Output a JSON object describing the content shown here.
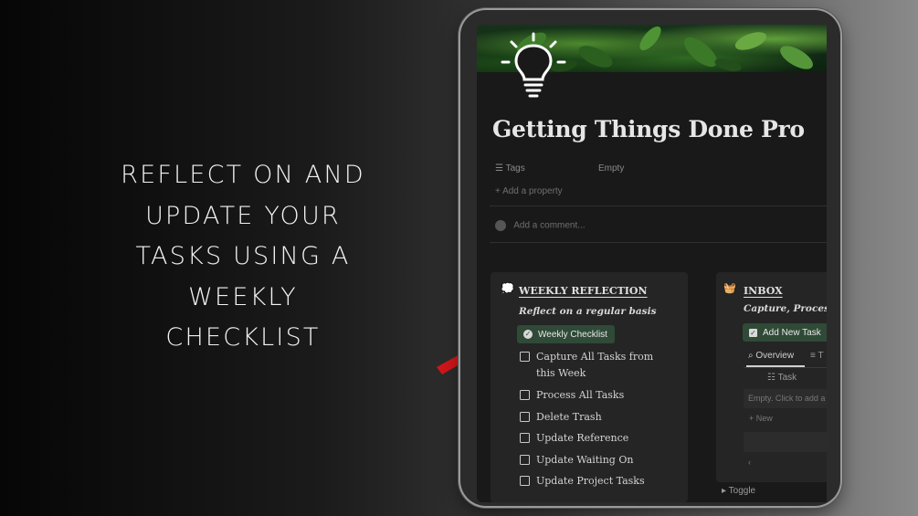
{
  "caption": {
    "lines": [
      "REFLECT ON AND",
      "UPDATE YOUR",
      "TASKS USING A",
      "WEEKLY",
      "CHECKLIST"
    ]
  },
  "page": {
    "title": "Getting Things Done Pro",
    "icon": "lightbulb-icon",
    "properties": {
      "tags_label": "Tags",
      "tags_value": "Empty",
      "add_property": "Add a property"
    },
    "comment_placeholder": "Add a comment..."
  },
  "weekly": {
    "title": "WEEKLY REFLECTION",
    "subtitle": "Reflect on a regular basis",
    "button": "Weekly Checklist",
    "items": [
      "Capture All Tasks from this Week",
      "Process All Tasks",
      "Delete Trash",
      "Update Reference",
      "Update Waiting On",
      "Update Project Tasks"
    ]
  },
  "inbox": {
    "title": "INBOX",
    "subtitle": "Capture, Process a",
    "button": "Add New Task",
    "tabs": [
      "Overview",
      "T"
    ],
    "column_header": "Task",
    "empty_text": "Empty. Click to add a",
    "new_label": "New",
    "toggle_label": "Toggle"
  },
  "colors": {
    "accent_green": "#2f4a37",
    "arrow_red": "#d0161a",
    "page_bg": "#191919"
  }
}
